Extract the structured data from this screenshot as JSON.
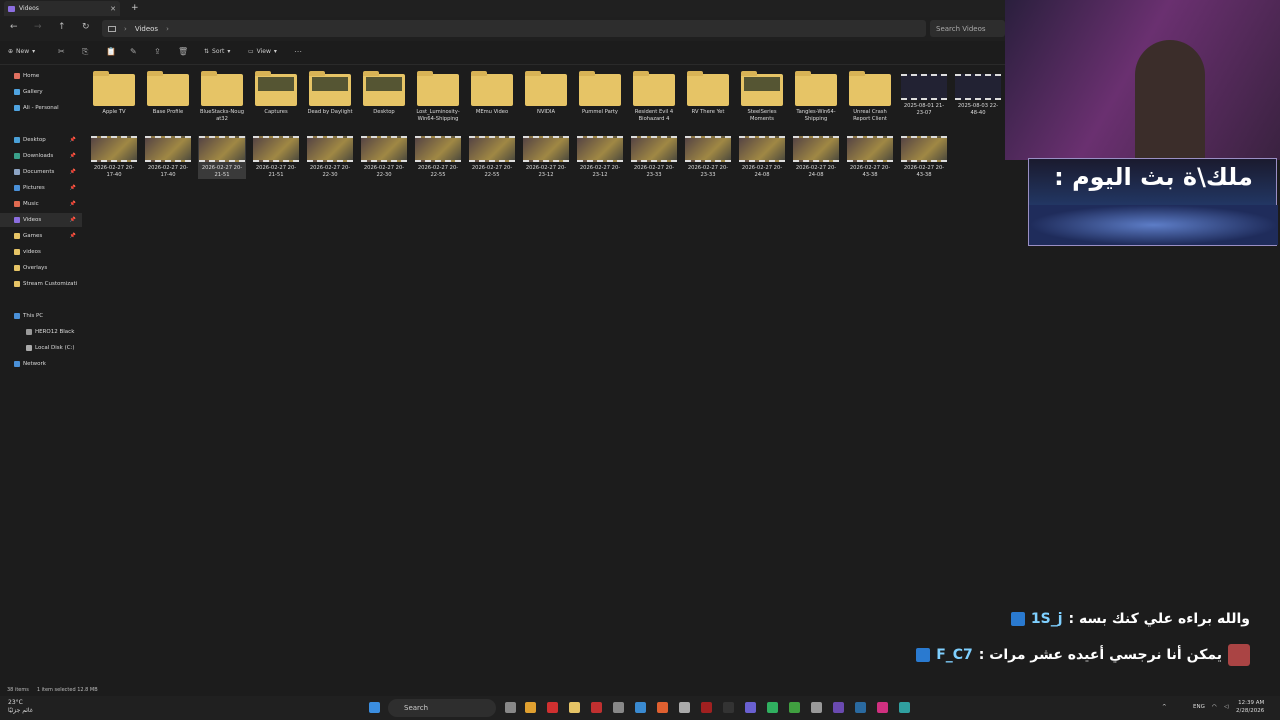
{
  "window": {
    "tab_title": "Videos"
  },
  "address": {
    "path": "Videos",
    "search_placeholder": "Search Videos"
  },
  "toolbar": {
    "new": "New",
    "sort": "Sort",
    "view": "View"
  },
  "sidebar": {
    "items": [
      {
        "label": "Home",
        "color": "#e07060",
        "pinned": false
      },
      {
        "label": "Gallery",
        "color": "#4fa3e0",
        "pinned": false
      },
      {
        "label": "Ali - Personal",
        "color": "#4fa3e0",
        "pinned": false
      },
      {
        "label": "Desktop",
        "color": "#4aa0d8",
        "pinned": true
      },
      {
        "label": "Downloads",
        "color": "#3aa08a",
        "pinned": true
      },
      {
        "label": "Documents",
        "color": "#8da4c4",
        "pinned": true
      },
      {
        "label": "Pictures",
        "color": "#4a90d8",
        "pinned": true
      },
      {
        "label": "Music",
        "color": "#e06a50",
        "pinned": true
      },
      {
        "label": "Videos",
        "color": "#8c6ee0",
        "pinned": true,
        "selected": true
      },
      {
        "label": "Games",
        "color": "#e6c466",
        "pinned": true
      },
      {
        "label": "videos",
        "color": "#e6c466",
        "pinned": false
      },
      {
        "label": "Overlays",
        "color": "#e6c466",
        "pinned": false
      },
      {
        "label": "Stream Customizati",
        "color": "#e6c466",
        "pinned": false
      },
      {
        "label": "This PC",
        "color": "#4a90d8",
        "pinned": false
      },
      {
        "label": "HERO12 Black",
        "color": "#999999",
        "pinned": false
      },
      {
        "label": "Local Disk (C:)",
        "color": "#aaaaaa",
        "pinned": false
      },
      {
        "label": "Network",
        "color": "#4a90d8",
        "pinned": false
      }
    ]
  },
  "files_row1": [
    {
      "label": "Apple TV",
      "type": "folder"
    },
    {
      "label": "Base Profile",
      "type": "folder"
    },
    {
      "label": "BlueStacks-Noug at32",
      "type": "folder"
    },
    {
      "label": "Captures",
      "type": "folder",
      "thumb": true
    },
    {
      "label": "Dead by Daylight",
      "type": "folder",
      "thumb": true
    },
    {
      "label": "Desktop",
      "type": "folder",
      "thumb": true
    },
    {
      "label": "Lost_Luminosity-Win64-Shipping",
      "type": "folder"
    },
    {
      "label": "MEmu Video",
      "type": "folder"
    },
    {
      "label": "NVIDIA",
      "type": "folder"
    },
    {
      "label": "Pummel Party",
      "type": "folder"
    },
    {
      "label": "Resident Evil 4 Biohazard 4",
      "type": "folder"
    },
    {
      "label": "RV There Yet",
      "type": "folder"
    },
    {
      "label": "SteelSeries Moments",
      "type": "folder",
      "thumb": true
    },
    {
      "label": "Tangles-Win64-Shipping",
      "type": "folder"
    },
    {
      "label": "Unreal Crash Report Client",
      "type": "folder"
    },
    {
      "label": "2025-08-01 21-23-07",
      "type": "video",
      "dark": true
    },
    {
      "label": "2025-08-03 22-48-40",
      "type": "video",
      "dark": true
    }
  ],
  "files_row2": [
    {
      "label": "2026-02-27 20-17-40"
    },
    {
      "label": "2026-02-27 20-17-40"
    },
    {
      "label": "2026-02-27 20-21-51",
      "selected": true
    },
    {
      "label": "2026-02-27 20-21-51"
    },
    {
      "label": "2026-02-27 20-22-30"
    },
    {
      "label": "2026-02-27 20-22-30"
    },
    {
      "label": "2026-02-27 20-22-55"
    },
    {
      "label": "2026-02-27 20-22-55"
    },
    {
      "label": "2026-02-27 20-23-12"
    },
    {
      "label": "2026-02-27 20-23-12"
    },
    {
      "label": "2026-02-27 20-23-33"
    },
    {
      "label": "2026-02-27 20-23-33"
    },
    {
      "label": "2026-02-27 20-24-08"
    },
    {
      "label": "2026-02-27 20-24-08"
    },
    {
      "label": "2026-02-27 20-43-38"
    },
    {
      "label": "2026-02-27 20-43-38"
    }
  ],
  "status": {
    "count": "38 items",
    "selection": "1 item selected  12.8 MB"
  },
  "taskbar": {
    "weather_temp": "23°C",
    "weather_desc": "غائم جزئيًا",
    "search": "Search",
    "lang": "ENG",
    "time": "12:39 AM",
    "date": "2/28/2026"
  },
  "overlay": {
    "banner_text": "ملك\\ة بث اليوم :",
    "chat": [
      {
        "user": "1S_j",
        "message": "والله براءه علي كنك بسه :"
      },
      {
        "user": "F_C7",
        "message": "يمكن أنا نرجسي أعيده عشر مرات :"
      }
    ]
  }
}
